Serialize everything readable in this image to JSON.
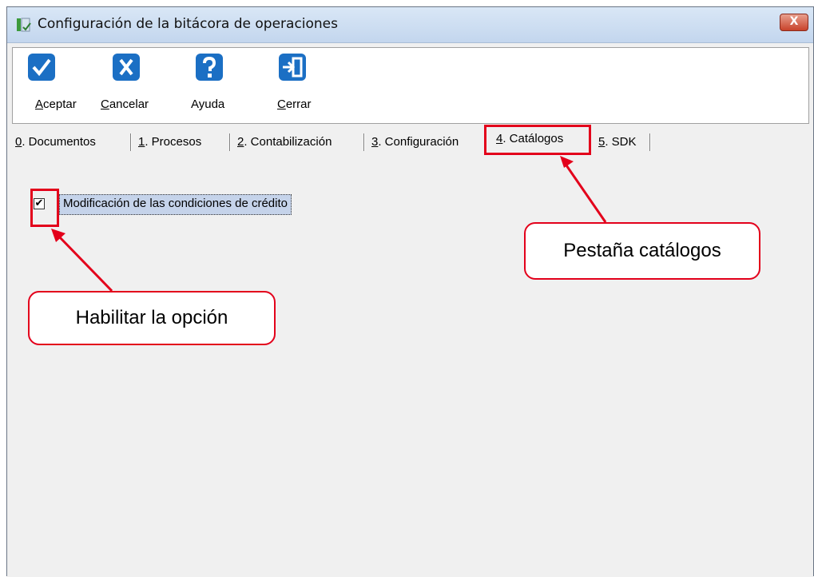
{
  "window": {
    "title": "Configuración de la bitácora de operaciones",
    "close_label": "X"
  },
  "toolbar": {
    "buttons": [
      {
        "label_accel": "A",
        "label_rest": "ceptar",
        "icon": "check-icon"
      },
      {
        "label_accel": "C",
        "label_rest": "ancelar",
        "icon": "x-icon"
      },
      {
        "label_accel": "",
        "label_rest": "Ayuda",
        "icon": "question-icon"
      },
      {
        "label_accel": "C",
        "label_rest": "errar",
        "icon": "exit-door-icon"
      }
    ]
  },
  "tabs": [
    {
      "accel": "0",
      "rest": ". Documentos"
    },
    {
      "accel": "1",
      "rest": ". Procesos"
    },
    {
      "accel": "2",
      "rest": ". Contabilización"
    },
    {
      "accel": "3",
      "rest": ". Configuración"
    },
    {
      "accel": "4",
      "rest": ". Catálogos"
    },
    {
      "accel": "5",
      "rest": ". SDK"
    }
  ],
  "active_tab_index": 4,
  "option": {
    "label": "Modificación de las condiciones de crédito",
    "checked": true,
    "check_glyph": "✔"
  },
  "annotations": {
    "tab_callout": "Pestaña catálogos",
    "option_callout": "Habilitar la opción"
  },
  "colors": {
    "accent_icon": "#1b6fc4",
    "annotation_red": "#e3001b",
    "selection": "#c5d3ea"
  }
}
